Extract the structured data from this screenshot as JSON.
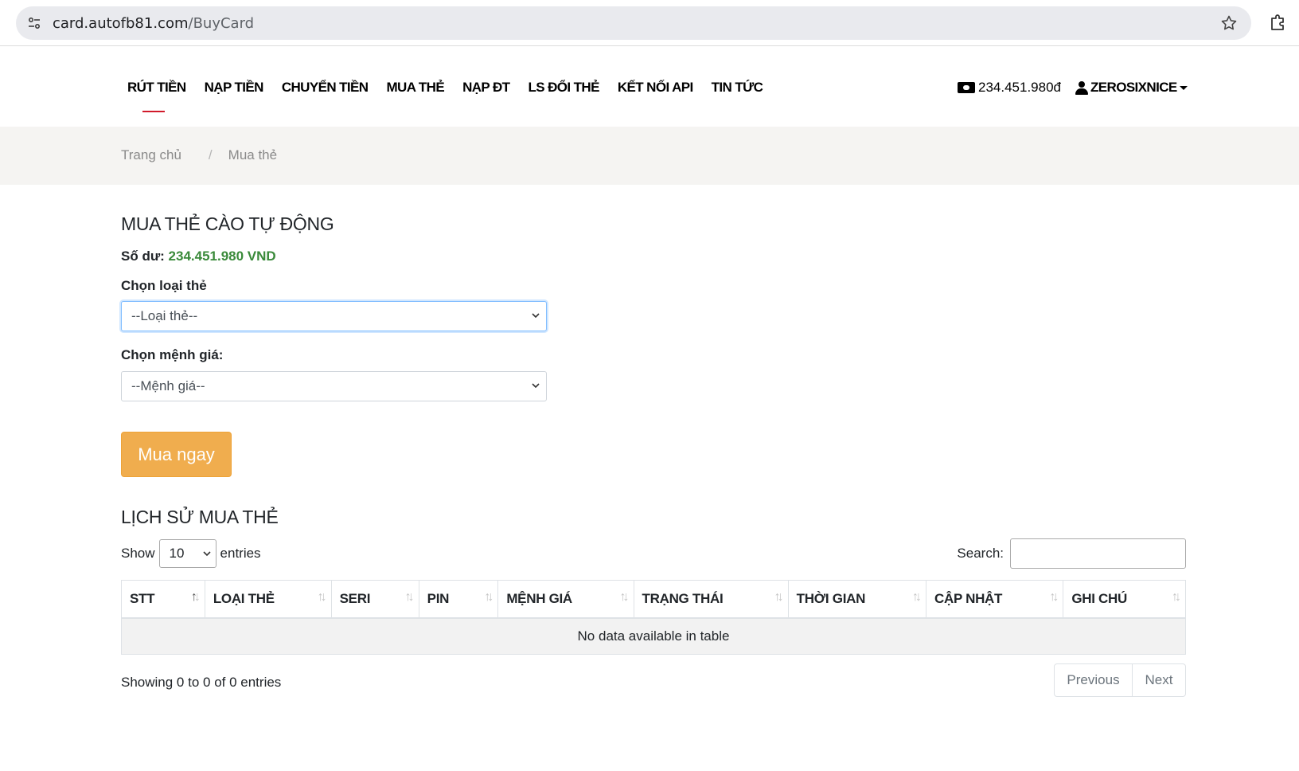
{
  "browser": {
    "url_host": "card.autofb81.com",
    "url_path": "/BuyCard"
  },
  "nav": {
    "items": [
      {
        "label": "RÚT TIỀN"
      },
      {
        "label": "NẠP TIỀN"
      },
      {
        "label": "CHUYỂN TIỀN"
      },
      {
        "label": "MUA THẺ"
      },
      {
        "label": "NẠP ĐT"
      },
      {
        "label": "LS ĐỔI THẺ"
      },
      {
        "label": "KẾT NỐI API"
      },
      {
        "label": "TIN TỨC"
      }
    ],
    "balance": "234.451.980đ",
    "username": "ZEROSIXNICE"
  },
  "breadcrumb": {
    "home": "Trang chủ",
    "separator": "/",
    "current": "Mua thẻ"
  },
  "form": {
    "title": "MUA THẺ CÀO TỰ ĐỘNG",
    "balance_label": "Số dư:",
    "balance_value": "234.451.980 VND",
    "card_type_label": "Chọn loại thẻ",
    "card_type_value": "--Loại thẻ--",
    "denomination_label": "Chọn mệnh giá:",
    "denomination_value": "--Mệnh giá--",
    "buy_button": "Mua ngay"
  },
  "history": {
    "title": "LỊCH SỬ MUA THẺ",
    "show_label": "Show",
    "page_length": "10",
    "entries_label": "entries",
    "search_label": "Search:",
    "search_value": "",
    "columns": [
      "STT",
      "LOẠI THẺ",
      "SERI",
      "PIN",
      "MỆNH GIÁ",
      "TRẠNG THÁI",
      "THỜI GIAN",
      "CẬP NHẬT",
      "GHI CHÚ"
    ],
    "empty_message": "No data available in table",
    "info": "Showing 0 to 0 of 0 entries",
    "prev_label": "Previous",
    "next_label": "Next"
  },
  "colors": {
    "accent_red": "#d11a2a",
    "balance_green": "#3a8a3a",
    "buy_button": "#f0ad4e"
  }
}
